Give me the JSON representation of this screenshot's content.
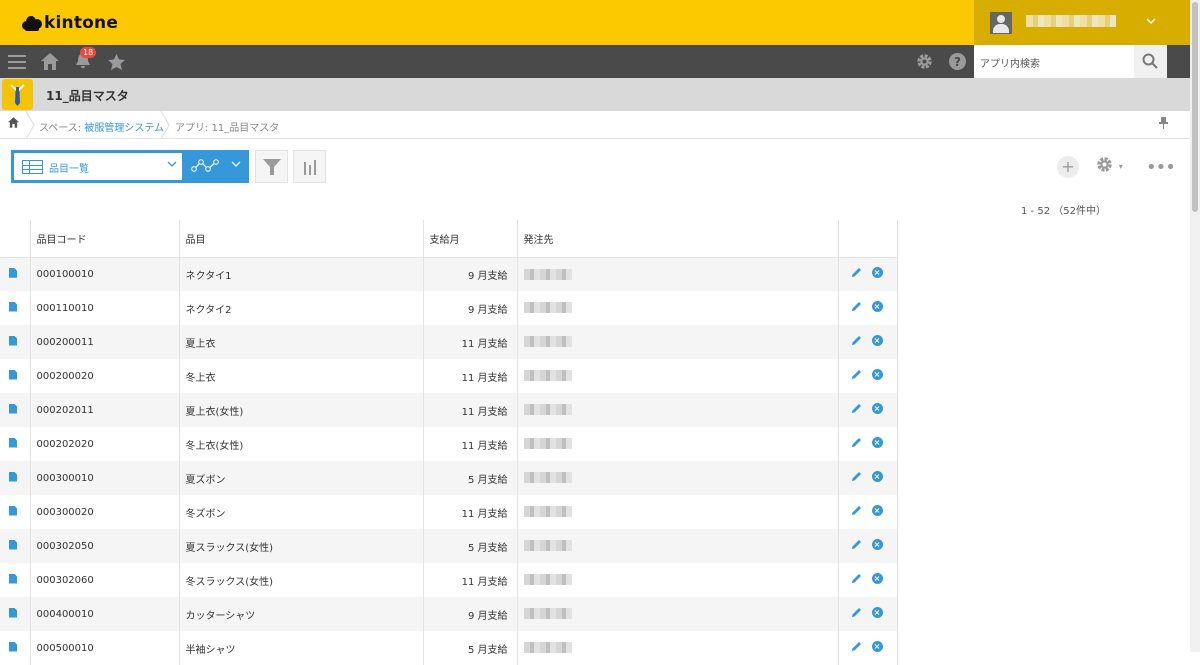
{
  "header": {
    "logo_text": "kintone",
    "user_name": ""
  },
  "nav": {
    "notification_count": "18",
    "search_placeholder": "アプリ内検索"
  },
  "app": {
    "title": "11_品目マスタ"
  },
  "breadcrumb": {
    "space_label": "スペース: ",
    "space_name": "被服管理システム",
    "app_label": "アプリ: 11_品目マスタ"
  },
  "toolbar": {
    "view_name": "品目一覧"
  },
  "pager": {
    "text": "1 - 52 （52件中）"
  },
  "table": {
    "columns": [
      "品目コード",
      "品目",
      "支給月",
      "発注先"
    ],
    "rows": [
      {
        "code": "000100010",
        "item": "ネクタイ1",
        "month": "9 月支給"
      },
      {
        "code": "000110010",
        "item": "ネクタイ2",
        "month": "9 月支給"
      },
      {
        "code": "000200011",
        "item": "夏上衣",
        "month": "11 月支給"
      },
      {
        "code": "000200020",
        "item": "冬上衣",
        "month": "11 月支給"
      },
      {
        "code": "000202011",
        "item": "夏上衣(女性)",
        "month": "11 月支給"
      },
      {
        "code": "000202020",
        "item": "冬上衣(女性)",
        "month": "11 月支給"
      },
      {
        "code": "000300010",
        "item": "夏ズボン",
        "month": "5 月支給"
      },
      {
        "code": "000300020",
        "item": "冬ズボン",
        "month": "11 月支給"
      },
      {
        "code": "000302050",
        "item": "夏スラックス(女性)",
        "month": "5 月支給"
      },
      {
        "code": "000302060",
        "item": "冬スラックス(女性)",
        "month": "11 月支給"
      },
      {
        "code": "000400010",
        "item": "カッターシャツ",
        "month": "9 月支給"
      },
      {
        "code": "000500010",
        "item": "半袖シャツ",
        "month": "5 月支給"
      }
    ]
  },
  "colors": {
    "brand": "#fcc800",
    "accent": "#3498db",
    "nav": "#4a4a4a"
  }
}
